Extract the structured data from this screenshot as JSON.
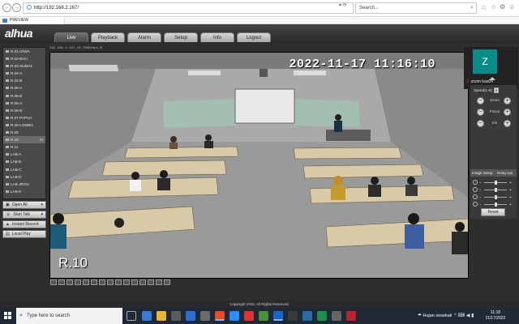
{
  "browser": {
    "url": "http://192.168.2.167/",
    "search_placeholder": "Search...",
    "tab_title": "PREVIEW",
    "nav_back": "←",
    "nav_forward": "→",
    "url_controls": "▾ ⟳",
    "window_controls": "—  ❐  ✕",
    "search_icon": "⌕",
    "home_icon": "⌂",
    "favorite_icon": "☆",
    "settings_icon": "⚙",
    "smiley_icon": "☺"
  },
  "app": {
    "logo": "alhua",
    "nav_tabs": [
      "Live",
      "Playback",
      "Alarm",
      "Setup",
      "Info",
      "Logout"
    ],
    "active_tab": "Live",
    "channels": [
      {
        "label": "R.01-JAWA",
        "marker": ""
      },
      {
        "label": "R.02-BALI",
        "marker": ""
      },
      {
        "label": "R.03-SUMA1",
        "marker": ""
      },
      {
        "label": "R.04-A",
        "marker": ""
      },
      {
        "label": "R.04-B",
        "marker": ""
      },
      {
        "label": "R.05-A",
        "marker": ""
      },
      {
        "label": "R.05-B",
        "marker": ""
      },
      {
        "label": "R.06-A",
        "marker": ""
      },
      {
        "label": "R.06-B",
        "marker": ""
      },
      {
        "label": "R.07-PAPUA",
        "marker": ""
      },
      {
        "label": "R.08-LOMBO",
        "marker": ""
      },
      {
        "label": "R.09",
        "marker": ""
      },
      {
        "label": "R.10",
        "marker": "M"
      },
      {
        "label": "R.11",
        "marker": ""
      },
      {
        "label": "LAB-A",
        "marker": ""
      },
      {
        "label": "LAB-B",
        "marker": ""
      },
      {
        "label": "LAB-C",
        "marker": ""
      },
      {
        "label": "LAB-D",
        "marker": ""
      },
      {
        "label": "LAB-JRGN",
        "marker": ""
      },
      {
        "label": "LAB-E",
        "marker": ""
      }
    ],
    "selected_channel": "R.10",
    "controls": [
      {
        "label": "Open All",
        "icon": "▣",
        "has_dropdown": true
      },
      {
        "label": "Start Talk",
        "icon": "☏",
        "has_dropdown": true
      },
      {
        "label": "Instant Record",
        "icon": "▲",
        "has_dropdown": false
      },
      {
        "label": "Local Play",
        "icon": "▤",
        "has_dropdown": false
      }
    ],
    "camera_meta": "192.168.2.167_10_7666kbps_M",
    "osd_time": "2022-11-17 11:16:10",
    "osd_channel": "R.10",
    "zoom": {
      "avatar_letter": "Z",
      "name": "zoom bas04",
      "mic_icon": "mic-muted-icon"
    },
    "ptz": {
      "speed_label": "Speed(1-8):",
      "speed_value": "5",
      "rows": [
        {
          "label": "Zoom",
          "minus": "−",
          "plus": "+"
        },
        {
          "label": "Focus",
          "minus": "−",
          "plus": "+"
        },
        {
          "label": "Iris",
          "minus": "−",
          "plus": "+"
        }
      ]
    },
    "image_setup": {
      "label": "Image Setup",
      "relay_label": "Relay-out",
      "sliders": [
        {
          "name": "brightness",
          "value": 0.5
        },
        {
          "name": "contrast",
          "value": 0.5
        },
        {
          "name": "saturation",
          "value": 0.5
        },
        {
          "name": "hue",
          "value": 0.5
        }
      ],
      "reset_label": "Reset"
    },
    "footer": "Copyright 2015, All Rights Reserved."
  },
  "taskbar": {
    "search_placeholder": "Type here to search",
    "weather": "Hujan sesekali",
    "time": "11:18",
    "date": "11/17/2022",
    "tray": "^ ⌨ ◀ ▮"
  },
  "colors": {
    "zoom_avatar": "#0b8a8a",
    "taskbar": "#1f2a36",
    "app_bg": "#2e2e2e"
  }
}
